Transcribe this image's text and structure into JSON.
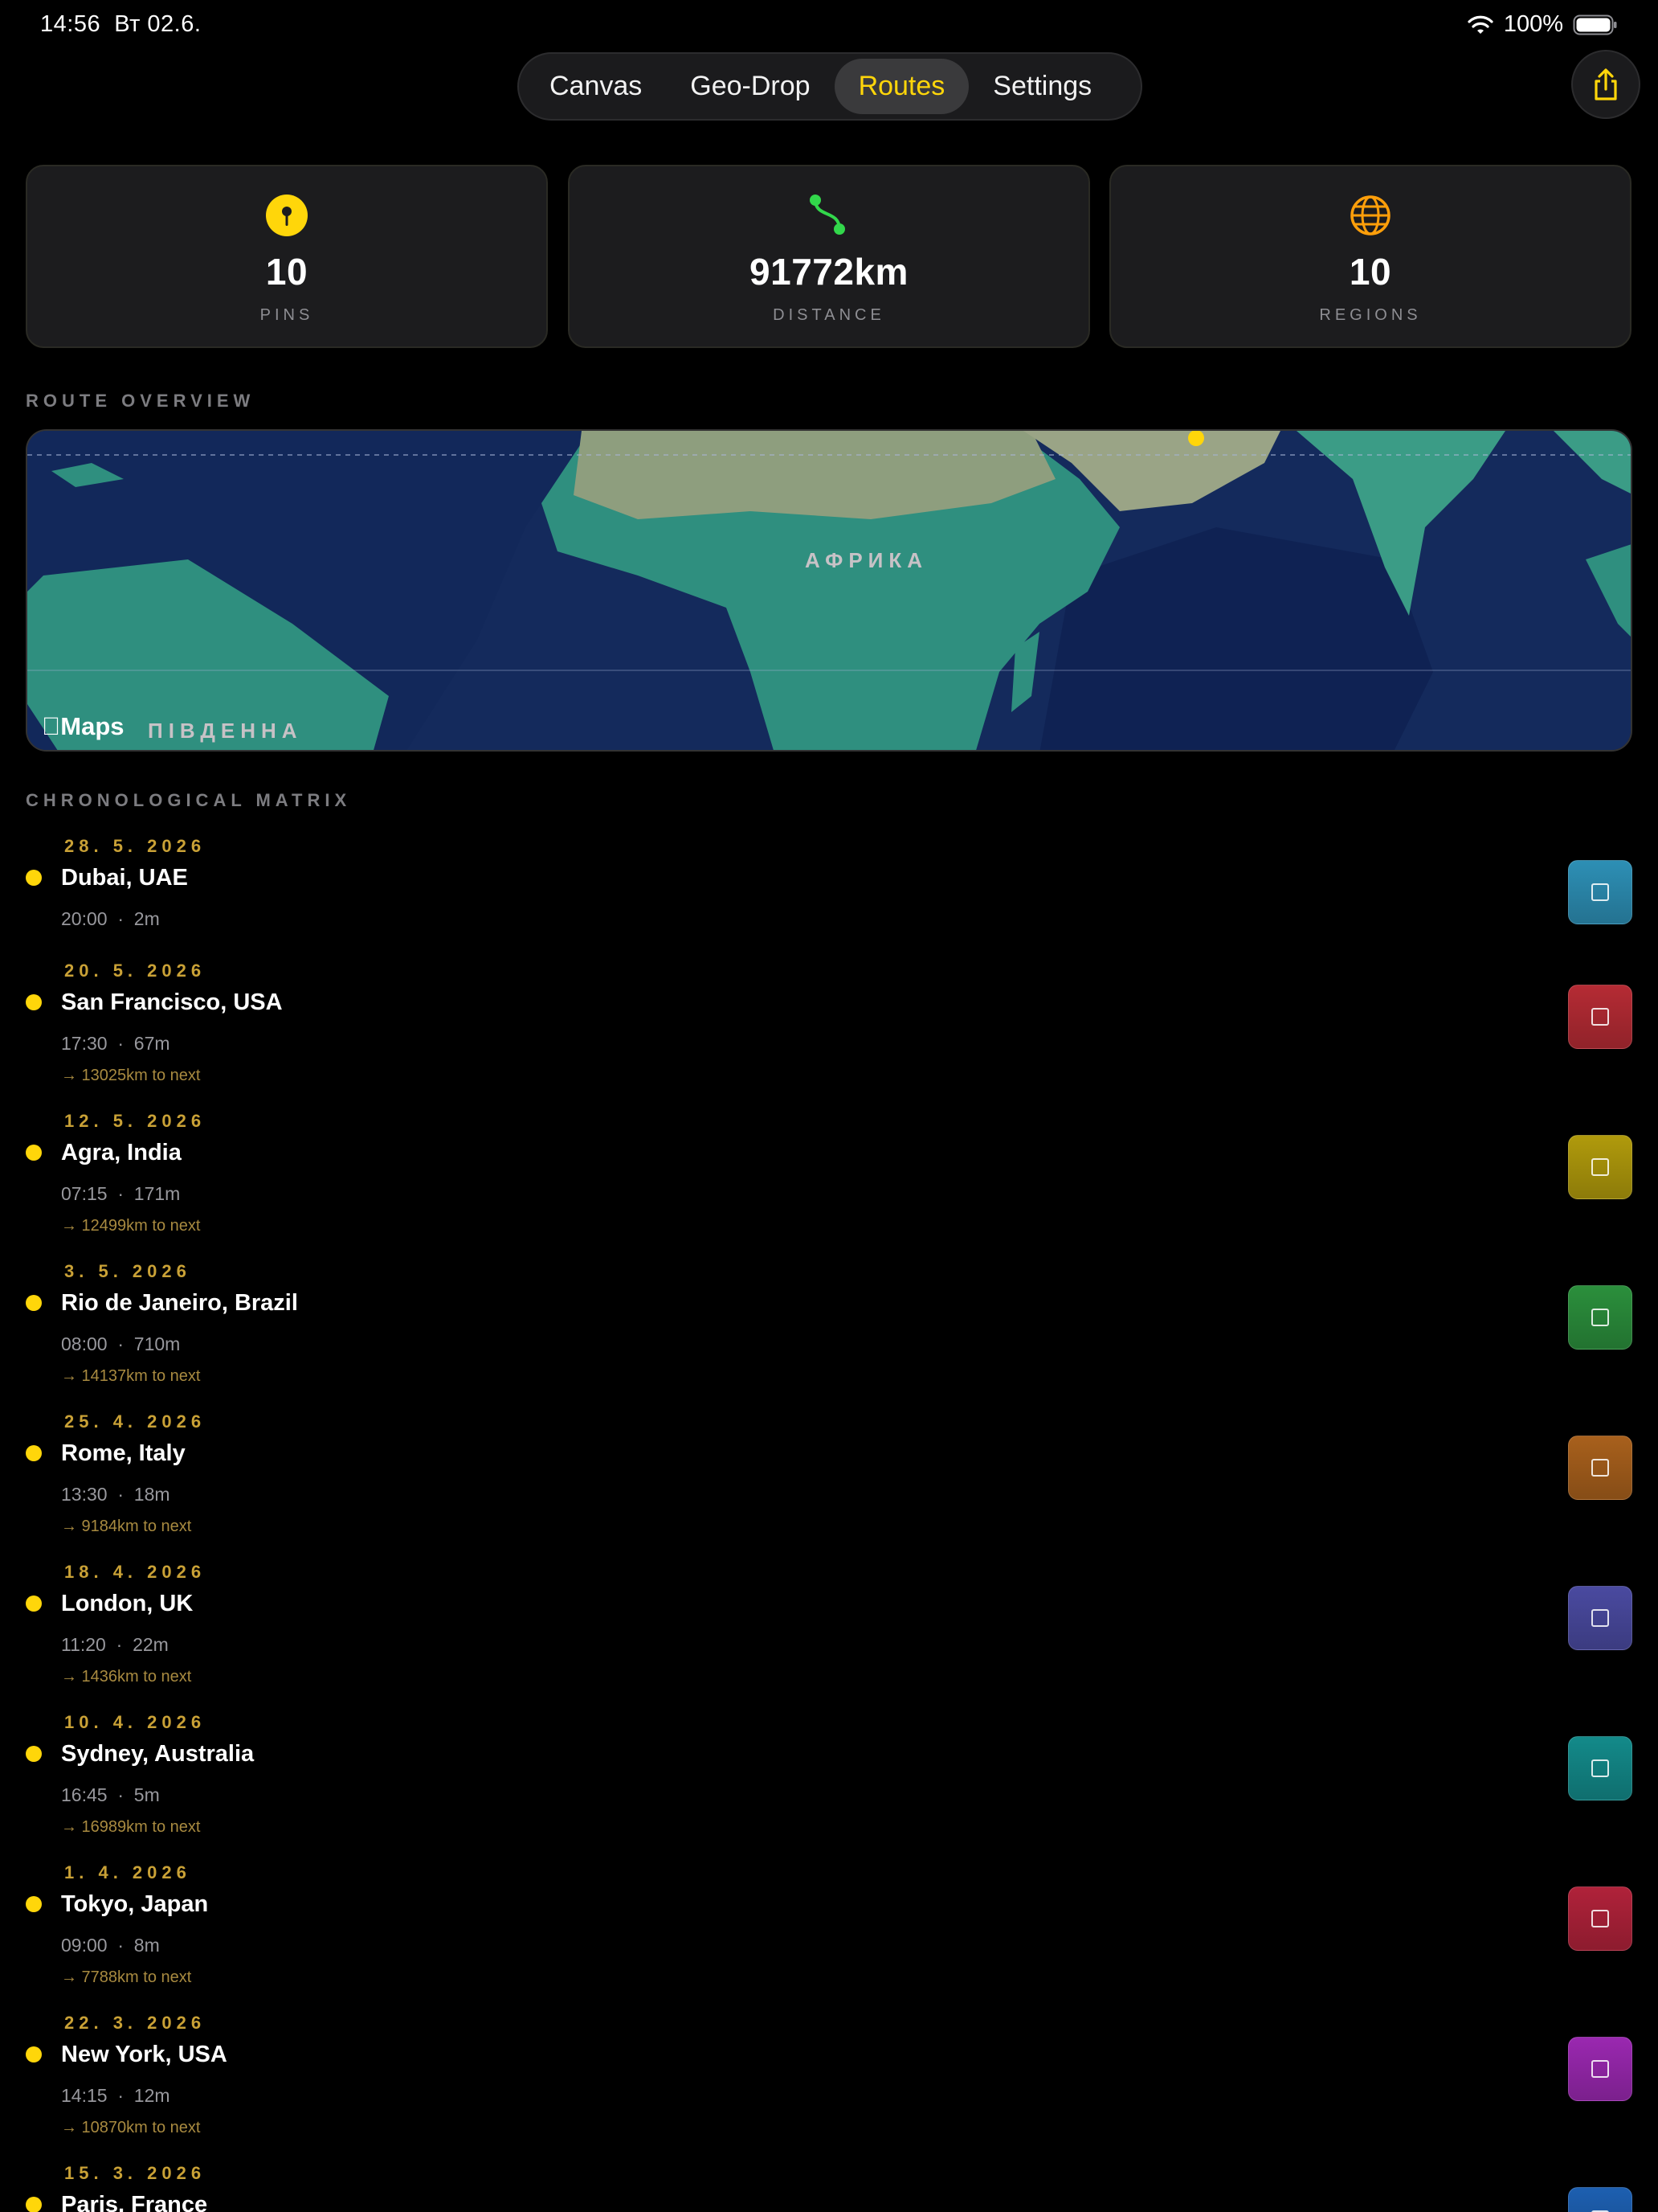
{
  "status_bar": {
    "time": "14:56",
    "date": "Вт 02.6.",
    "battery": "100%"
  },
  "tabs": [
    {
      "label": "Canvas",
      "active": false
    },
    {
      "label": "Geo-Drop",
      "active": false
    },
    {
      "label": "Routes",
      "active": true
    },
    {
      "label": "Settings",
      "active": false
    }
  ],
  "stats": [
    {
      "value": "10",
      "label": "PINS",
      "icon": "pin-icon"
    },
    {
      "value": "91772km",
      "label": "DISTANCE",
      "icon": "route-icon"
    },
    {
      "value": "10",
      "label": "REGIONS",
      "icon": "globe-icon"
    }
  ],
  "route_overview": {
    "heading": "ROUTE OVERVIEW",
    "maps_label": "Maps",
    "africa_label": "АФРИКА",
    "south_america_label": "ПІВДЕННА"
  },
  "matrix": {
    "heading": "CHRONOLOGICAL MATRIX",
    "entries": [
      {
        "date": "28. 5. 2026",
        "city": "Dubai, UAE",
        "meta": "20:00  ·  2m",
        "next": "",
        "color": "#2d8fb5"
      },
      {
        "date": "20. 5. 2026",
        "city": "San Francisco, USA",
        "meta": "17:30  ·  67m",
        "next": "→ 13025km to next",
        "color": "#b52b34"
      },
      {
        "date": "12. 5. 2026",
        "city": "Agra, India",
        "meta": "07:15  ·  171m",
        "next": "→ 12499km to next",
        "color": "#b09a0c"
      },
      {
        "date": "3. 5. 2026",
        "city": "Rio de Janeiro, Brazil",
        "meta": "08:00  ·  710m",
        "next": "→ 14137km to next",
        "color": "#2b8f3c"
      },
      {
        "date": "25. 4. 2026",
        "city": "Rome, Italy",
        "meta": "13:30  ·  18m",
        "next": "→ 9184km to next",
        "color": "#a8601c"
      },
      {
        "date": "18. 4. 2026",
        "city": "London, UK",
        "meta": "11:20  ·  22m",
        "next": "→ 1436km to next",
        "color": "#4a4aa0"
      },
      {
        "date": "10. 4. 2026",
        "city": "Sydney, Australia",
        "meta": "16:45  ·  5m",
        "next": "→ 16989km to next",
        "color": "#138a8a"
      },
      {
        "date": "1. 4. 2026",
        "city": "Tokyo, Japan",
        "meta": "09:00  ·  8m",
        "next": "→ 7788km to next",
        "color": "#b0223a"
      },
      {
        "date": "22. 3. 2026",
        "city": "New York, USA",
        "meta": "14:15  ·  12m",
        "next": "→ 10870km to next",
        "color": "#9a28b0"
      },
      {
        "date": "15. 3. 2026",
        "city": "Paris, France",
        "meta": "",
        "next": "",
        "color": "#1d5fb0"
      }
    ]
  }
}
